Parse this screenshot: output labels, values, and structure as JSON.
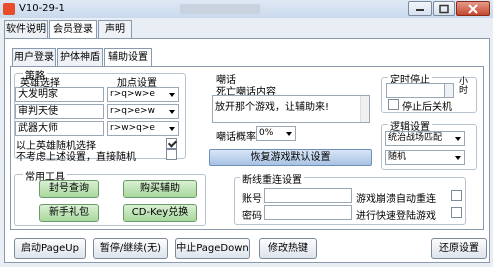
{
  "window": {
    "title": "V10-29-1"
  },
  "top_tabs": [
    "软件说明",
    "会员登录",
    "声明"
  ],
  "sub_tabs": [
    "用户登录",
    "护体神盾",
    "辅助设置"
  ],
  "strategy": {
    "label": "策略",
    "col_hero": "英雄选择",
    "col_skill": "加点设置",
    "rows": [
      {
        "hero": "大发明家",
        "skill": "r>q>w>e"
      },
      {
        "hero": "审判天使",
        "skill": "r>q>e>w"
      },
      {
        "hero": "武器大师",
        "skill": "r>w>q>e"
      }
    ],
    "random_hero": "以上英雄随机选择",
    "random_hero_checked": true,
    "not_consider": "不考虑上述设置，直接随机",
    "not_consider_checked": false
  },
  "taunt": {
    "label": "嘲话",
    "death_label": "死亡嘲话内容",
    "death_text": "放开那个游戏，让辅助来!",
    "prob_label": "嘲话概率",
    "prob_value": "0%"
  },
  "timed_stop": {
    "label": "定时停止",
    "hours": "",
    "unit": "小时",
    "shutdown_label": "停止后关机"
  },
  "logic": {
    "label": "逻辑设置",
    "mode": "统治战场匹配",
    "order": "随机"
  },
  "restore_button": "恢复游戏默认设置",
  "tools": {
    "label": "常用工具",
    "buttons": [
      "封号查询",
      "购买辅助",
      "新手礼包",
      "CD-Key兑换"
    ]
  },
  "reconnect": {
    "label": "断线重连设置",
    "account_label": "账号",
    "password_label": "密码",
    "crash_label": "游戏崩溃自动重连",
    "quick_label": "进行快速登陆游戏"
  },
  "footer": {
    "start": "启动PageUp",
    "pause": "暂停/继续(无)",
    "stop": "中止PageDown",
    "hotkey": "修改热键",
    "restore": "还原设置"
  }
}
